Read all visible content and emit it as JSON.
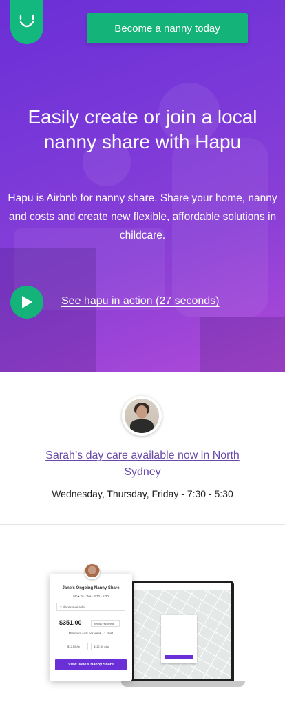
{
  "header": {
    "logo_icon": "hapu-smile-logo",
    "cta_label": "Become a nanny today",
    "accent_color": "#13b37a",
    "brand_color": "#6a2fd6"
  },
  "hero": {
    "title": "Easily create or join a local nanny share with Hapu",
    "subtitle": "Hapu is Airbnb for nanny share. Share your home, nanny and costs and create new flexible, affordable solutions in childcare.",
    "play_icon": "play-icon",
    "video_link": "See hapu in action (27 seconds)"
  },
  "listing": {
    "avatar": "carer-avatar",
    "title": "Sarah’s day care available now in North Sydney",
    "times": "Wednesday, Thursday, Friday - 7:30 - 5:30",
    "link_color": "#6a4aa8"
  },
  "mockup": {
    "card_title": "Jane's Ongoing Nanny Share",
    "card_days": "Mo • Tu • We · 8:30 - 5:30",
    "card_places": "3 places available",
    "card_price": "$351.00",
    "card_recurring": "weekly recurring",
    "card_minimum": "Minimum cost per week - 1 child",
    "card_rate_a": "$12.50 /hr",
    "card_rate_b": "$112.50 /day",
    "card_cta": "View Jane's Nanny Share"
  }
}
